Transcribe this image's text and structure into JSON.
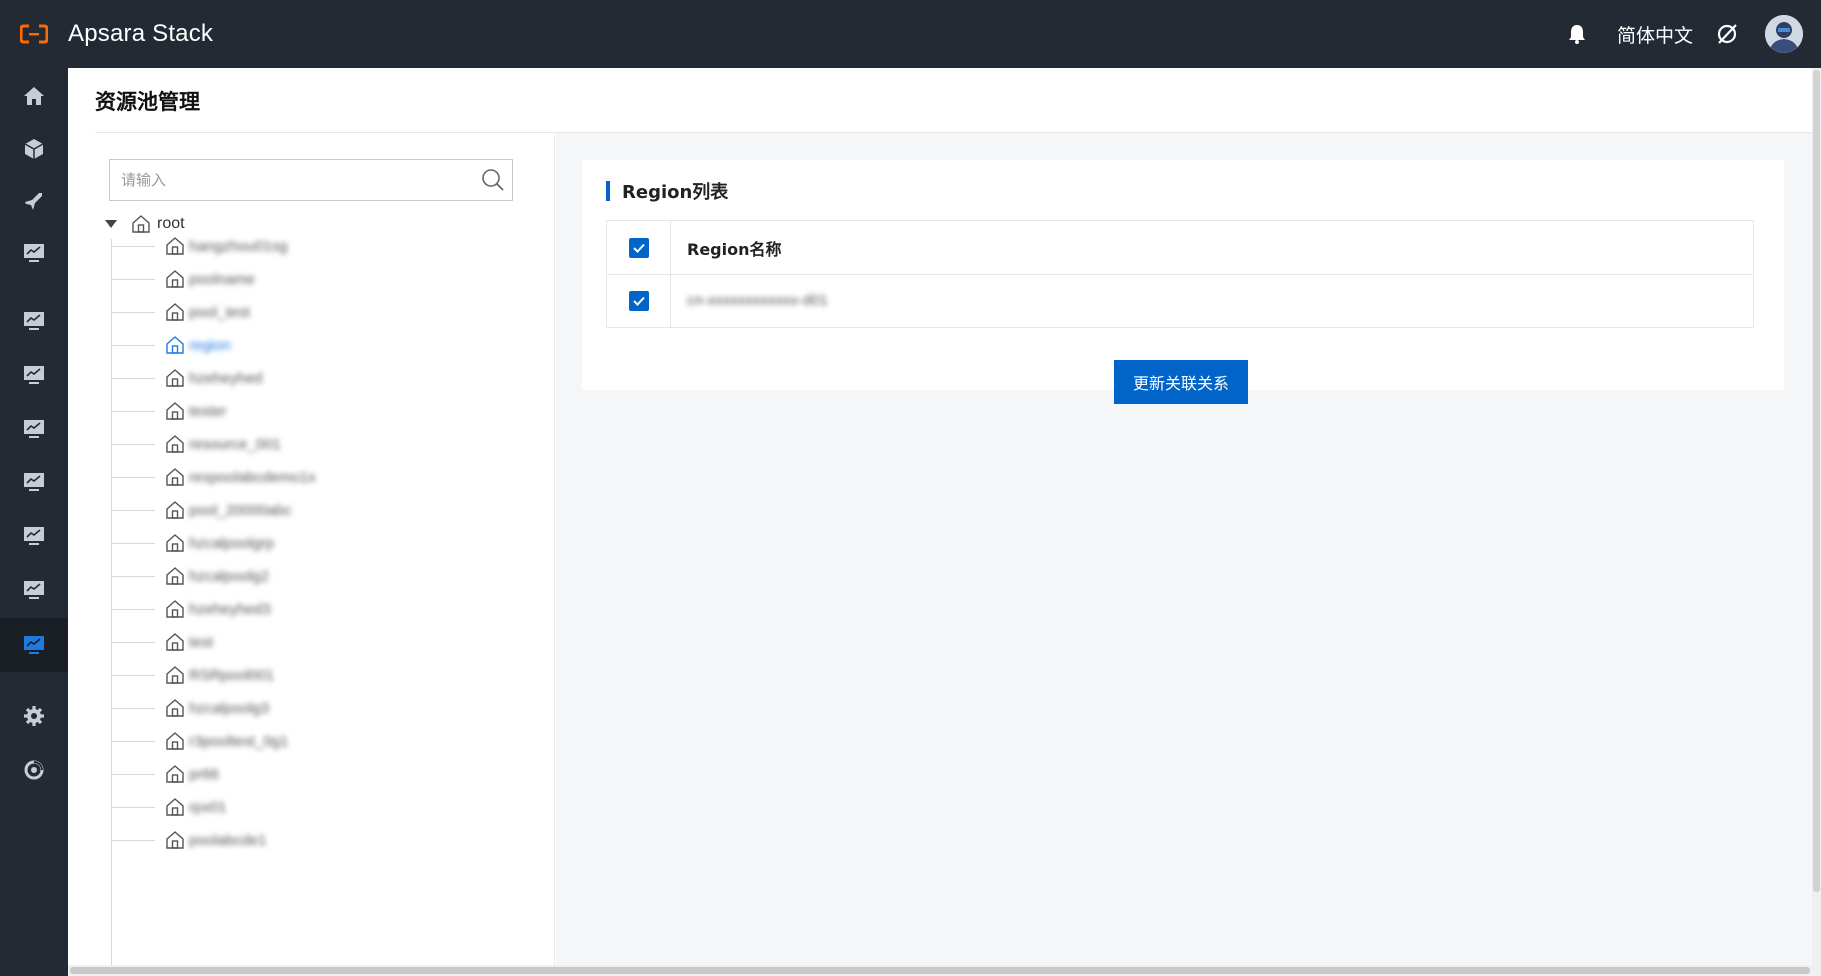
{
  "app": {
    "title": "Apsara Stack"
  },
  "header": {
    "language": "简体中文"
  },
  "sidebar": {
    "items": [
      {
        "icon": "home-icon"
      },
      {
        "icon": "cube-icon"
      },
      {
        "icon": "rocket-icon"
      },
      {
        "icon": "monitor-chart-icon"
      },
      {
        "icon": "monitor-chart-icon"
      },
      {
        "icon": "monitor-chart-icon"
      },
      {
        "icon": "monitor-chart-icon"
      },
      {
        "icon": "monitor-chart-icon"
      },
      {
        "icon": "monitor-chart-icon"
      },
      {
        "icon": "monitor-chart-icon"
      },
      {
        "icon": "monitor-chart-icon",
        "active": true
      },
      {
        "icon": "gear-icon"
      },
      {
        "icon": "refresh-circle-icon"
      }
    ]
  },
  "page": {
    "title": "资源池管理"
  },
  "search": {
    "placeholder": "请输入",
    "value": ""
  },
  "tree": {
    "root_label": "root",
    "nodes": [
      {
        "label": "hangzhou01sg"
      },
      {
        "label": "poolname"
      },
      {
        "label": "pool_test"
      },
      {
        "label": "region",
        "selected": true
      },
      {
        "label": "hzeheyhed"
      },
      {
        "label": "tester"
      },
      {
        "label": "resource_001"
      },
      {
        "label": "respoolabcdemo1x"
      },
      {
        "label": "pool_20000abc"
      },
      {
        "label": "hzcalpoolgrp"
      },
      {
        "label": "hzcalpoolg2"
      },
      {
        "label": "hzeheyhed3"
      },
      {
        "label": "test"
      },
      {
        "label": "RSRpool001"
      },
      {
        "label": "hzcalpoolg3"
      },
      {
        "label": "r3pooltest_0g1"
      },
      {
        "label": "pr66"
      },
      {
        "label": "rpx01"
      },
      {
        "label": "poolabcde1"
      }
    ]
  },
  "region_panel": {
    "title": "Region列表",
    "column_header": "Region名称",
    "rows": [
      {
        "name": "cn-xxxxxxxxxxxx-d01"
      }
    ],
    "update_button": "更新关联关系"
  },
  "colors": {
    "accent": "#0064c8",
    "topbar_bg": "#232a33",
    "logo": "#ff6a00",
    "selected_node": "#1f7ae0"
  }
}
